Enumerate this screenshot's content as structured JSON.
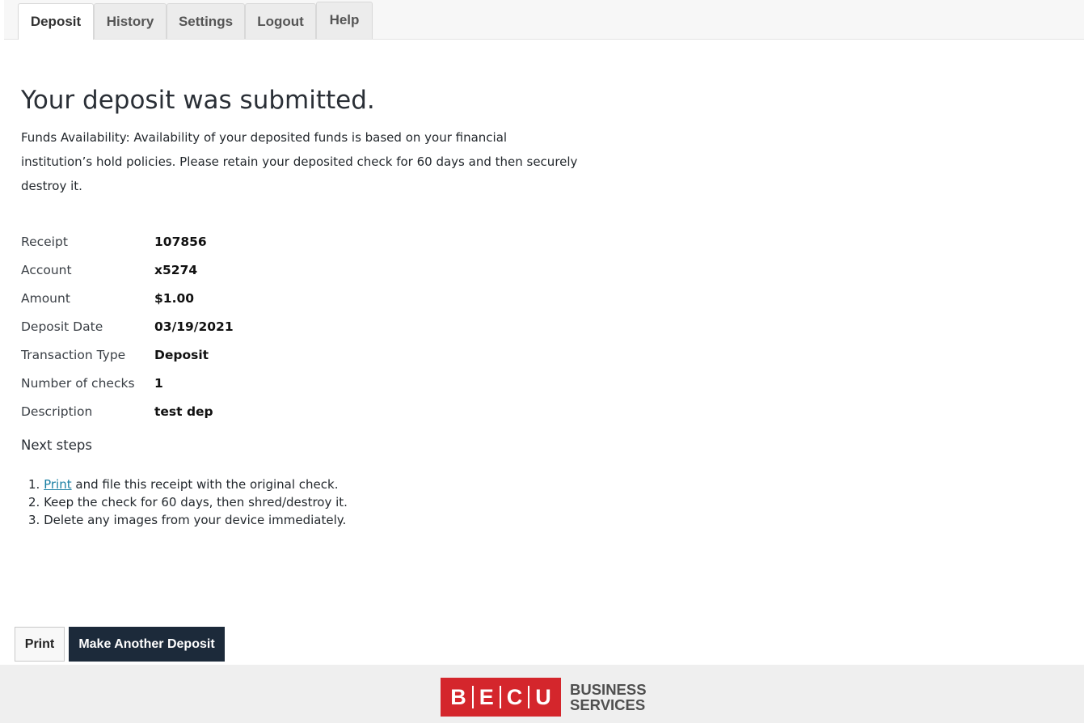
{
  "tabs": [
    {
      "label": "Deposit",
      "active": true
    },
    {
      "label": "History",
      "active": false
    },
    {
      "label": "Settings",
      "active": false
    },
    {
      "label": "Logout",
      "active": false
    },
    {
      "label": "Help",
      "active": false
    }
  ],
  "confirmation": {
    "title": "Your deposit was submitted.",
    "funds_text": "Funds Availability: Availability of your deposited funds is based on your financial institution’s hold policies. Please retain your deposited check for 60 days and then securely destroy it."
  },
  "details": [
    {
      "label": "Receipt",
      "value": "107856"
    },
    {
      "label": "Account",
      "value": "x5274"
    },
    {
      "label": "Amount",
      "value": "$1.00"
    },
    {
      "label": "Deposit Date",
      "value": "03/19/2021"
    },
    {
      "label": "Transaction Type",
      "value": "Deposit"
    },
    {
      "label": "Number of checks",
      "value": "1"
    },
    {
      "label": "Description",
      "value": "test dep"
    }
  ],
  "next_steps": {
    "title": "Next steps",
    "step1_number": "1.",
    "step1_link": "Print",
    "step1_rest": " and file this receipt with the original check.",
    "step2": "2. Keep the check for 60 days, then shred/destroy it.",
    "step3": "3. Delete any images from your device immediately."
  },
  "buttons": {
    "print_label": "Print",
    "another_label": "Make Another Deposit"
  },
  "footer": {
    "logo_letters": [
      "B",
      "E",
      "C",
      "U"
    ],
    "logo_line1": "BUSINESS",
    "logo_line2": "SERVICES",
    "brand_color": "#d4262c"
  }
}
